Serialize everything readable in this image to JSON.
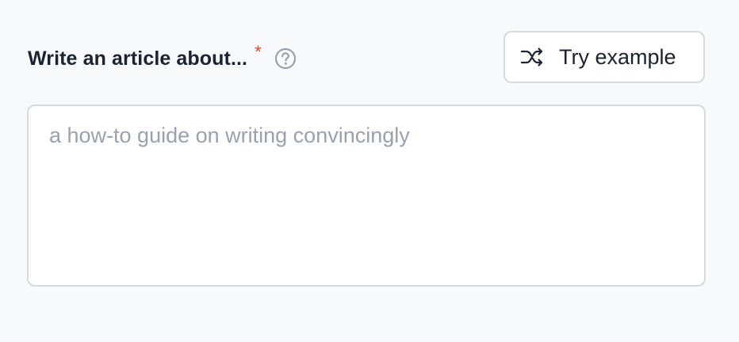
{
  "prompt_field": {
    "label": "Write an article about...",
    "required_marker": "*",
    "help_icon": "question-circle-icon",
    "placeholder": "a how-to guide on writing convincingly",
    "value": ""
  },
  "try_example_button": {
    "label": "Try example",
    "icon": "shuffle-icon"
  },
  "colors": {
    "background": "#f8f9fb",
    "text": "#1b2230",
    "required": "#d9472b",
    "placeholder": "#9aa1ac",
    "border": "#d6d9de"
  }
}
